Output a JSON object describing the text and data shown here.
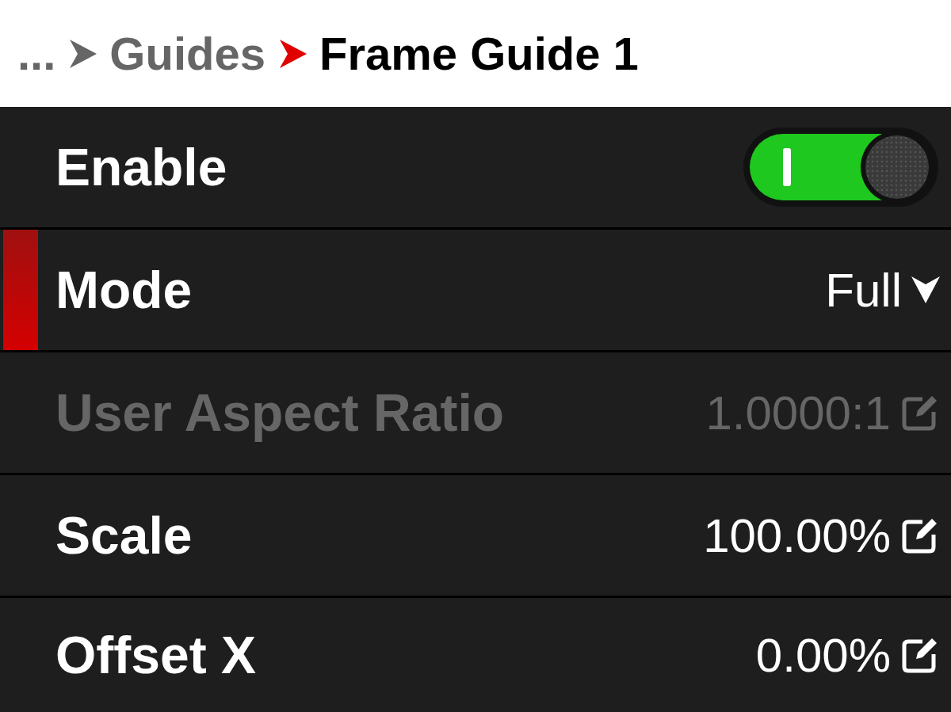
{
  "breadcrumb": [
    {
      "label": "..."
    },
    {
      "label": "Guides"
    },
    {
      "label": "Frame Guide 1"
    }
  ],
  "settings": [
    {
      "kind": "toggle",
      "label": "Enable",
      "on": true,
      "selected": false,
      "disabled": false
    },
    {
      "kind": "dropdown",
      "label": "Mode",
      "value": "Full",
      "selected": true,
      "disabled": false
    },
    {
      "kind": "edit",
      "label": "User Aspect Ratio",
      "value": "1.0000:1",
      "selected": false,
      "disabled": true
    },
    {
      "kind": "edit",
      "label": "Scale",
      "value": "100.00%",
      "selected": false,
      "disabled": false
    },
    {
      "kind": "edit",
      "label": "Offset X",
      "value": "0.00%",
      "selected": false,
      "disabled": false
    }
  ]
}
